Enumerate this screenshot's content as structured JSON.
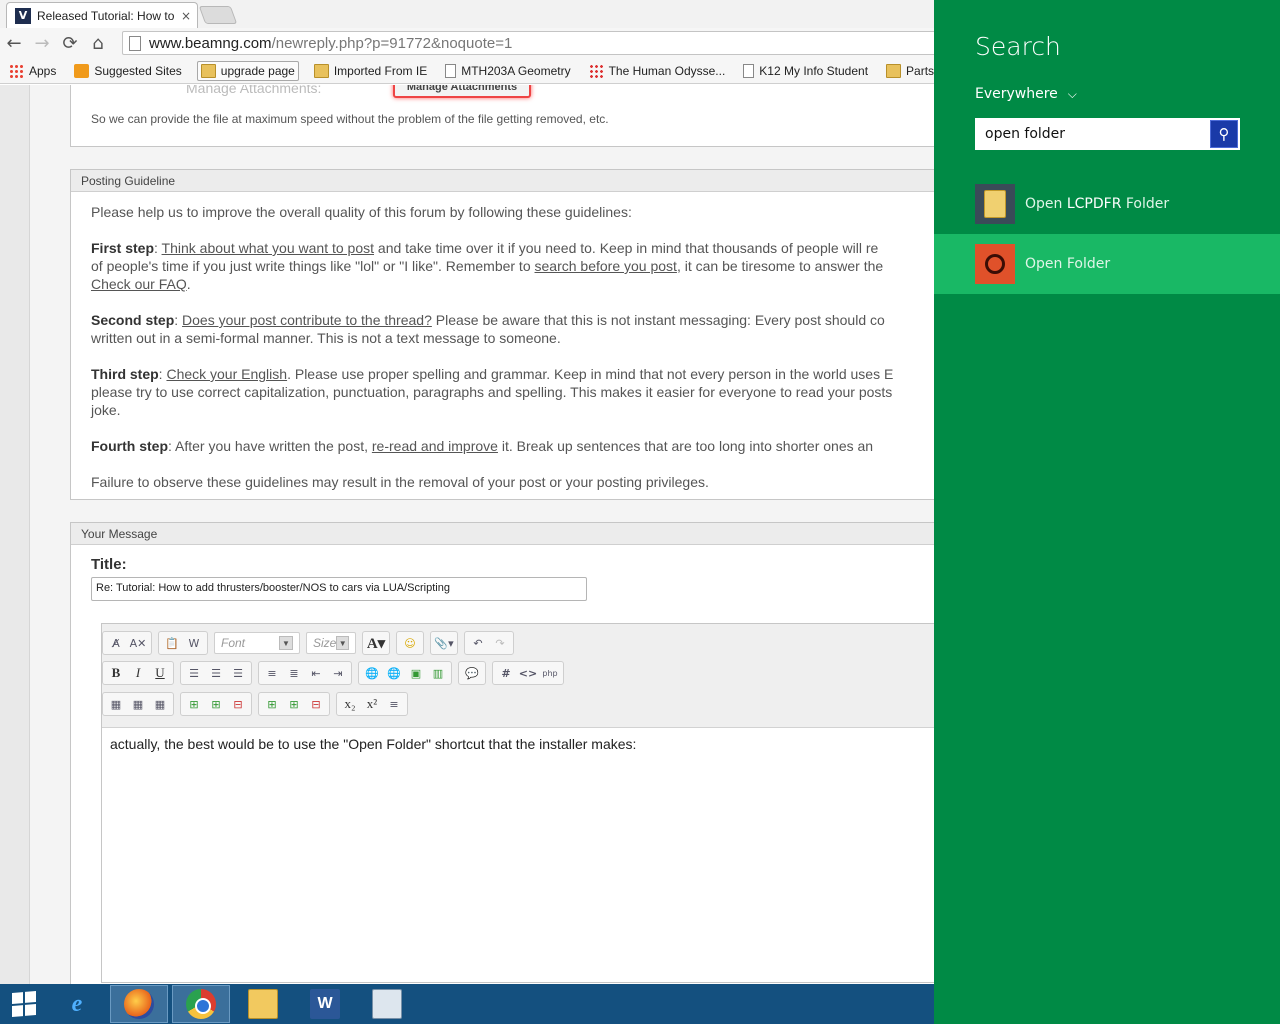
{
  "browser": {
    "tab_title": "Released Tutorial: How to",
    "tab_close": "×",
    "url_host": "www.beamng.com",
    "url_path": "/newreply.php?p=91772&noquote=1",
    "nav": {
      "back": "←",
      "forward": "→",
      "reload": "⟳",
      "home": "⌂"
    },
    "bookmarks": [
      {
        "label": "Apps",
        "icon": "apps-grid-icon"
      },
      {
        "label": "Suggested Sites",
        "icon": "suggested-sites-icon"
      },
      {
        "label": "upgrade page",
        "icon": "folder-icon"
      },
      {
        "label": "Imported From IE",
        "icon": "folder-icon"
      },
      {
        "label": "MTH203A Geometry",
        "icon": "page-icon"
      },
      {
        "label": "The Human Odysse...",
        "icon": "dots-icon"
      },
      {
        "label": "K12 My Info Student",
        "icon": "page-icon"
      },
      {
        "label": "Parts For My",
        "icon": "folder-icon"
      }
    ]
  },
  "attachments": {
    "label": "Manage Attachments:",
    "button": "Manage Attachments",
    "note": "So we can provide the file at maximum speed without the problem of the file getting removed, etc."
  },
  "guidelines": {
    "header": "Posting Guideline",
    "intro": "Please help us to improve the overall quality of this forum by following these guidelines:",
    "steps": [
      {
        "title": "First step",
        "link": "Think about what you want to post",
        "text": " and take time over it if you need to. Keep in mind that thousands of people will re",
        "line2_pre": "of people's time if you just write things like \"lol\" or \"I like\". Remember to ",
        "link2": "search before you post",
        "line2_post": ", it can be tiresome to answer the",
        "link3": "Check our FAQ",
        "line3_post": "."
      },
      {
        "title": "Second step",
        "link": "Does your post contribute to the thread?",
        "text": " Please be aware that this is not instant messaging: Every post should co",
        "line2": "written out in a semi-formal manner. This is not a text message to someone."
      },
      {
        "title": "Third step",
        "link": "Check your English",
        "text": ". Please use proper spelling and grammar. Keep in mind that not every person in the world uses E",
        "line2": "please try to use correct capitalization, punctuation, paragraphs and spelling. This makes it easier for everyone to read your posts",
        "line3": "joke."
      },
      {
        "title": "Fourth step",
        "pre": ": After you have written the post, ",
        "link": "re-read and improve",
        "text": " it. Break up sentences that are too long into shorter ones an"
      }
    ],
    "footer": "Failure to observe these guidelines may result in the removal of your post or your posting privileges."
  },
  "message": {
    "header": "Your Message",
    "title_label": "Title:",
    "title_value": "Re: Tutorial: How to add thrusters/booster/NOS to cars via LUA/Scripting",
    "font_placeholder": "Font",
    "size_placeholder": "Size",
    "body": "actually, the best would be to use the \"Open Folder\" shortcut that the installer makes:"
  },
  "charm": {
    "title": "Search",
    "scope": "Everywhere",
    "query": "open folder",
    "results": [
      {
        "pre": "Open ",
        "highlight": "LCPDFR",
        "post": " Folder",
        "icon": "folder-icon",
        "selected": false
      },
      {
        "pre": "",
        "highlight": "",
        "post": "Open Folder",
        "icon": "ubuntu-icon",
        "selected": true
      }
    ]
  },
  "taskbar": {
    "apps": [
      "internet-explorer",
      "firefox",
      "chrome",
      "file-explorer",
      "word",
      "calculator"
    ],
    "word_letter": "W"
  }
}
